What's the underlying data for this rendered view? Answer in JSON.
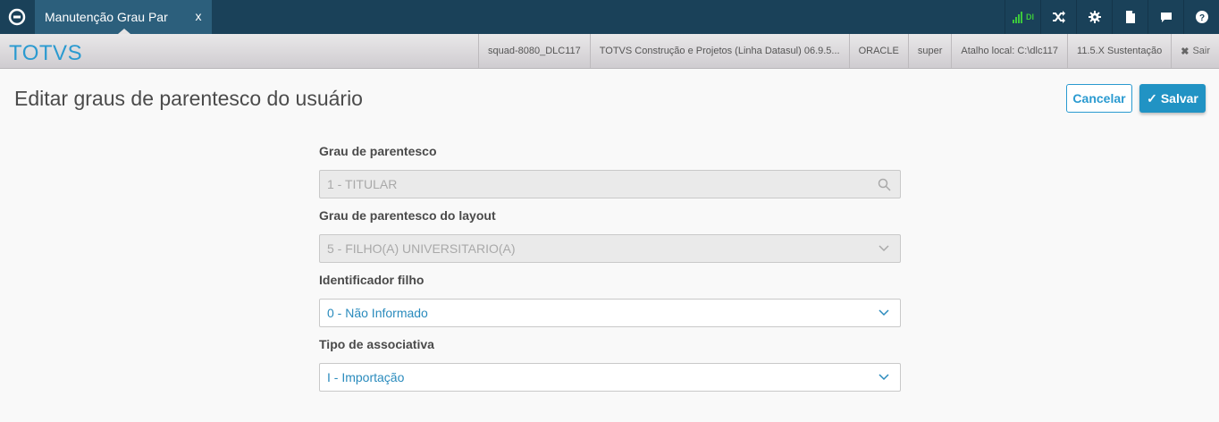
{
  "topbar": {
    "tab_label": "Manutenção Grau Par",
    "tab_close": "x",
    "signal_text": "DI",
    "icons": [
      "shuffle-icon",
      "gear-icon",
      "document-icon",
      "chat-icon",
      "help-icon"
    ]
  },
  "subbar": {
    "brand": "TOTVS",
    "info": [
      "squad-8080_DLC117",
      "TOTVS Construção e Projetos (Linha Datasul) 06.9.5...",
      "ORACLE",
      "super",
      "Atalho local: C:\\dlc117",
      "11.5.X Sustentação"
    ],
    "logout_label": "Sair"
  },
  "page": {
    "title": "Editar graus de parentesco do usuário",
    "cancel_label": "Cancelar",
    "save_label": "Salvar"
  },
  "form": {
    "grau": {
      "label": "Grau de parentesco",
      "value": "1 - TITULAR"
    },
    "grau_layout": {
      "label": "Grau de parentesco do layout",
      "value": "5 - FILHO(A) UNIVERSITARIO(A)"
    },
    "identificador": {
      "label": "Identificador filho",
      "value": "0 - Não Informado"
    },
    "tipo": {
      "label": "Tipo de associativa",
      "value": "I - Importação"
    }
  },
  "colors": {
    "topbar": "#1a4159",
    "tab": "#2c5f7c",
    "accent": "#2a9ad0",
    "signal": "#3cc93c"
  }
}
